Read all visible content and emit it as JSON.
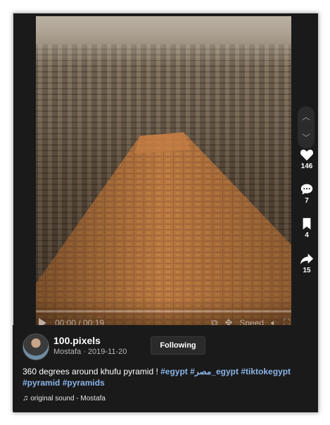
{
  "video": {
    "time_current": "00:00",
    "time_total": "00:19",
    "speed_label": "Speed"
  },
  "actions": {
    "likes": "146",
    "comments": "7",
    "saves": "4",
    "shares": "15"
  },
  "post": {
    "username": "100.pixels",
    "author": "Mostafa",
    "date": "2019-11-20",
    "follow_label": "Following",
    "caption": "360 degrees around khufu pyramid ! ",
    "hashtags": [
      "#egypt",
      "#مصر_egypt",
      "#tiktokegypt",
      "#pyramid",
      "#pyramids"
    ],
    "sound": "original sound - Mostafa"
  },
  "icons": {
    "play": "play-icon",
    "like": "heart-icon",
    "comment": "comment-icon",
    "save": "bookmark-icon",
    "share": "share-icon",
    "note": "music-note-icon"
  },
  "colors": {
    "background": "#1a1a1a",
    "hashtag": "#8ab4e8"
  }
}
